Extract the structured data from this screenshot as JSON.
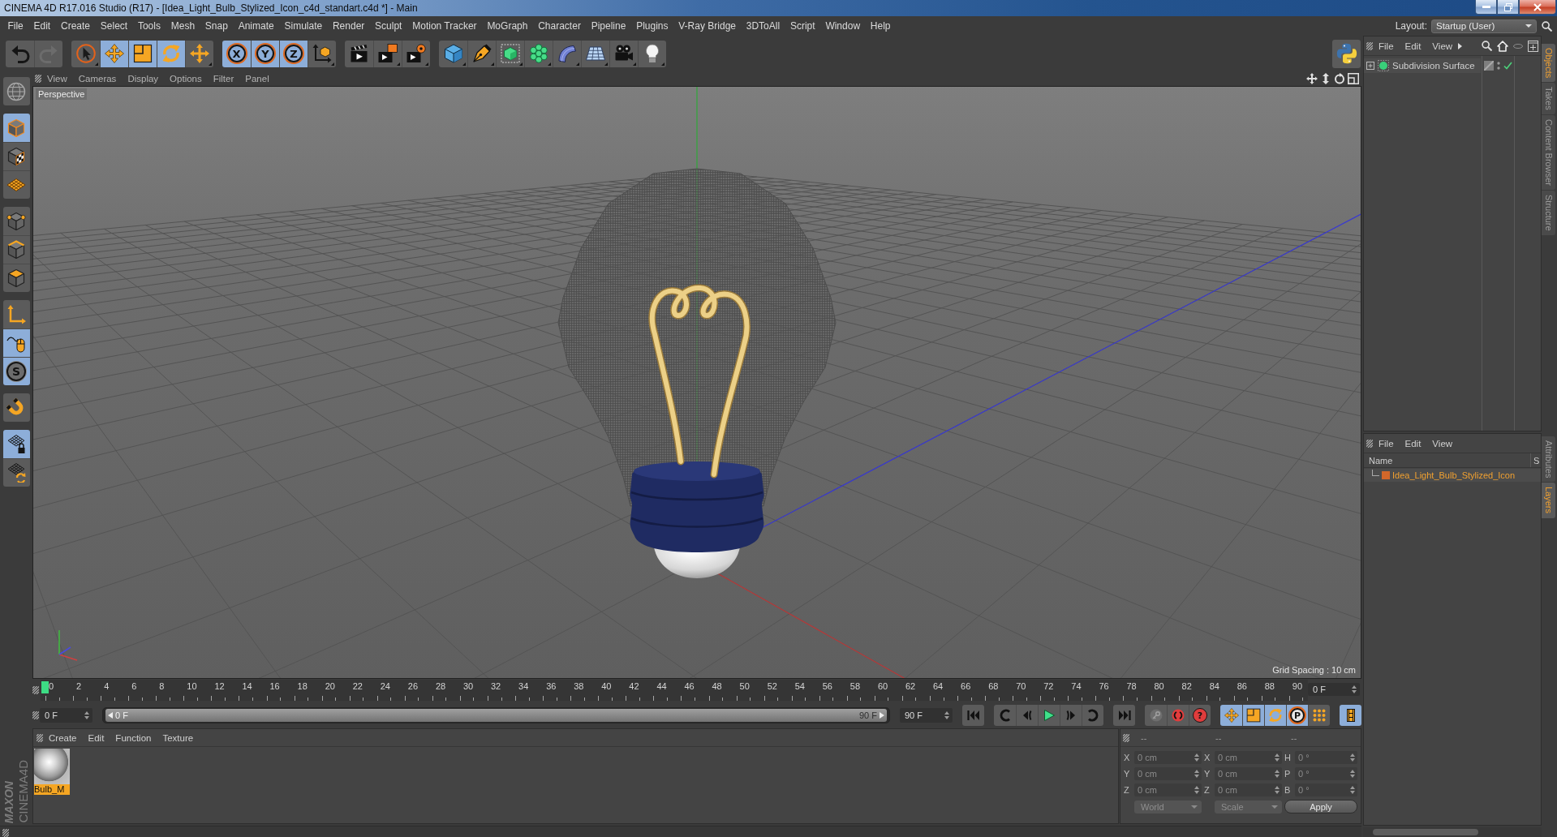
{
  "window": {
    "title": "CINEMA 4D R17.016 Studio (R17) - [Idea_Light_Bulb_Stylized_Icon_c4d_standart.c4d *] - Main"
  },
  "menu_bar": {
    "items": [
      "File",
      "Edit",
      "Create",
      "Select",
      "Tools",
      "Mesh",
      "Snap",
      "Animate",
      "Simulate",
      "Render",
      "Sculpt",
      "Motion Tracker",
      "MoGraph",
      "Character",
      "Pipeline",
      "Plugins",
      "V-Ray Bridge",
      "3DToAll",
      "Script",
      "Window",
      "Help"
    ],
    "layout_label": "Layout:",
    "layout_value": "Startup (User)"
  },
  "toolbar": {
    "history": [
      {
        "disabled": false
      },
      {
        "disabled": true
      }
    ],
    "tools": [
      {
        "selected": false
      },
      {
        "selected": true
      },
      {
        "selected": true
      },
      {
        "selected": true
      },
      {
        "selected": false
      }
    ],
    "axis_locks": [
      {
        "label": "X",
        "selected": true
      },
      {
        "label": "Y",
        "selected": true
      },
      {
        "label": "Z",
        "selected": true
      }
    ]
  },
  "left_palette": {
    "groups": [
      [
        {
          "selected": false
        }
      ],
      [
        {
          "selected": true
        },
        {
          "selected": false
        },
        {
          "selected": false
        }
      ],
      [
        {
          "selected": false
        },
        {
          "selected": false
        },
        {
          "selected": false
        }
      ],
      [
        {
          "selected": false
        },
        {
          "selected": true
        },
        {
          "selected": true,
          "label": "S"
        }
      ],
      [
        {
          "selected": false
        }
      ],
      [
        {
          "selected": true
        },
        {
          "selected": false
        }
      ]
    ]
  },
  "logo": {
    "brand": "MAXON",
    "product": "CINEMA4D"
  },
  "viewport": {
    "menu": [
      "View",
      "Cameras",
      "Display",
      "Options",
      "Filter",
      "Panel"
    ],
    "camera": "Perspective",
    "grid_spacing": "Grid Spacing : 10 cm"
  },
  "timeline": {
    "ticks": [
      "0",
      "2",
      "4",
      "6",
      "8",
      "10",
      "12",
      "14",
      "16",
      "18",
      "20",
      "22",
      "24",
      "26",
      "28",
      "30",
      "32",
      "34",
      "36",
      "38",
      "40",
      "42",
      "44",
      "46",
      "48",
      "50",
      "52",
      "54",
      "56",
      "58",
      "60",
      "62",
      "64",
      "66",
      "68",
      "70",
      "72",
      "74",
      "76",
      "78",
      "80",
      "82",
      "84",
      "86",
      "88",
      "90"
    ],
    "level": 0,
    "current_frame": "0 F"
  },
  "transport": {
    "start_frame": "0 F",
    "range": {
      "start": "0 F",
      "end": "90 F",
      "level": 1
    },
    "end_frame": "90 F",
    "record": [
      {
        "disabled": true
      },
      {
        "disabled": false
      },
      {
        "disabled": false,
        "label": "?"
      }
    ],
    "key_filters": [
      {
        "selected": true
      },
      {
        "selected": true
      },
      {
        "selected": true
      },
      {
        "selected": true,
        "label": "P"
      },
      {
        "selected": false
      }
    ],
    "timeline_button": {
      "selected": true
    }
  },
  "materials": {
    "menu": [
      "Create",
      "Edit",
      "Function",
      "Texture"
    ],
    "items": [
      {
        "name": "Bulb_M",
        "selected": true
      }
    ]
  },
  "coordinates": {
    "headers": [
      "--",
      "--",
      "--"
    ],
    "columns": [
      [
        {
          "axis": "X",
          "value": "0 cm"
        },
        {
          "axis": "Y",
          "value": "0 cm"
        },
        {
          "axis": "Z",
          "value": "0 cm"
        }
      ],
      [
        {
          "axis": "X",
          "value": "0 cm"
        },
        {
          "axis": "Y",
          "value": "0 cm"
        },
        {
          "axis": "Z",
          "value": "0 cm"
        }
      ],
      [
        {
          "axis": "H",
          "value": "0 °"
        },
        {
          "axis": "P",
          "value": "0 °"
        },
        {
          "axis": "B",
          "value": "0 °"
        }
      ]
    ],
    "mode": "World",
    "size_mode": "Scale",
    "apply": "Apply"
  },
  "objects": {
    "menu": [
      "File",
      "Edit",
      "View"
    ],
    "items": [
      {
        "name": "Subdivision Surface",
        "expanded": false,
        "enabled": true,
        "selected": false
      }
    ]
  },
  "layers": {
    "menu": [
      "File",
      "Edit",
      "View"
    ],
    "columns": [
      "Name",
      "S"
    ],
    "items": [
      {
        "name": "Idea_Light_Bulb_Stylized_Icon",
        "color": "#d2672a",
        "selected": true
      }
    ]
  },
  "side_tabs": {
    "top": [
      {
        "label": "Objects",
        "selected": true
      },
      {
        "label": "Takes",
        "selected": false
      },
      {
        "label": "Content Browser",
        "selected": false
      },
      {
        "label": "Structure",
        "selected": false
      }
    ],
    "bottom": [
      {
        "label": "Attributes",
        "selected": false
      },
      {
        "label": "Layers",
        "selected": true
      }
    ]
  }
}
